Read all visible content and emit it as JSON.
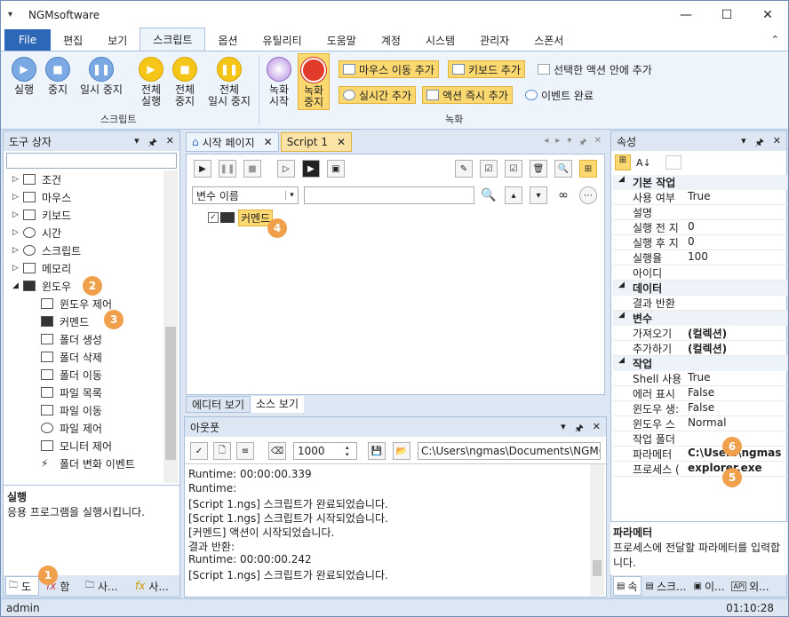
{
  "app": {
    "title": "NGMsoftware"
  },
  "menu": {
    "tabs": [
      "File",
      "편집",
      "보기",
      "스크립트",
      "옵션",
      "유틸리티",
      "도움말",
      "계정",
      "시스템",
      "관리자",
      "스폰서"
    ],
    "active": "스크립트"
  },
  "ribbon": {
    "run": "실행",
    "stop": "중지",
    "pause": "일시 중지",
    "run_all": [
      "전체",
      "실행"
    ],
    "stop_all": [
      "전체",
      "중지"
    ],
    "pause_all": [
      "전체",
      "일시 중지"
    ],
    "script_group": "스크립트",
    "rec_start": [
      "녹화",
      "시작"
    ],
    "rec_stop": [
      "녹화",
      "중지"
    ],
    "add_mouse": "마우스 이동 추가",
    "add_keyboard": "키보드 추가",
    "add_in_action": "선택한 액션 안에 추가",
    "add_realtime": "실시간 추가",
    "add_action_now": "액션 즉시 추가",
    "event_done": "이벤트 완료",
    "record_group": "녹화"
  },
  "toolbox": {
    "title": "도구 상자",
    "items": [
      "조건",
      "마우스",
      "키보드",
      "시간",
      "스크립트",
      "메모리",
      "윈도우"
    ],
    "children": [
      "윈도우 제어",
      "커멘드",
      "폴더 생성",
      "폴더 삭제",
      "폴더 이동",
      "파일 목록",
      "파일 이동",
      "파일 제어",
      "모니터 제어",
      "폴더 변화 이벤트"
    ],
    "desc_title": "실행",
    "desc_text": "응용 프로그램을 실행시킵니다.",
    "bottom_tabs": [
      "도",
      "함",
      "사...",
      "사..."
    ]
  },
  "editor": {
    "tabs": [
      "시작 페이지",
      "Script 1"
    ],
    "var_select": "변수 이름",
    "node_label": "커멘드",
    "view_tabs": [
      "에디터 보기",
      "소스 보기"
    ]
  },
  "output": {
    "title": "아웃풋",
    "count": "1000",
    "path": "C:\\Users\\ngmas\\Documents\\NGM6\\",
    "lines": [
      "Runtime: 00:00:00.339",
      "Runtime:",
      "[Script 1.ngs] 스크립트가 완료되었습니다.",
      "[Script 1.ngs] 스크립트가 시작되었습니다.",
      "[커멘드] 액션이 시작되었습니다.",
      "결과 반환:",
      "Runtime: 00:00:00.242",
      "[Script 1.ngs] 스크립트가 완료되었습니다."
    ]
  },
  "properties": {
    "title": "속성",
    "rows": [
      {
        "cat": true,
        "k": "기본 작업"
      },
      {
        "k": "사용 여부",
        "v": "True"
      },
      {
        "k": "설명",
        "v": ""
      },
      {
        "k": "실행 전 지",
        "v": "0"
      },
      {
        "k": "실행 후 지",
        "v": "0"
      },
      {
        "k": "실행율",
        "v": "100"
      },
      {
        "k": "아이디",
        "v": ""
      },
      {
        "cat": true,
        "k": "데이터"
      },
      {
        "k": "결과 반환",
        "v": ""
      },
      {
        "cat": true,
        "k": "변수"
      },
      {
        "k": "가져오기",
        "v": "(컬렉션)",
        "bold": true
      },
      {
        "k": "추가하기",
        "v": "(컬렉션)",
        "bold": true
      },
      {
        "cat": true,
        "k": "작업"
      },
      {
        "k": "Shell 사용",
        "v": "True"
      },
      {
        "k": "에러 표시",
        "v": "False"
      },
      {
        "k": "윈도우 생:",
        "v": "False"
      },
      {
        "k": "윈도우 스",
        "v": "Normal"
      },
      {
        "k": "작업 폴더",
        "v": ""
      },
      {
        "k": "파라메터",
        "v": "C:\\Users\\ngmas",
        "bold": true
      },
      {
        "k": "프로세스 (",
        "v": "explorer.exe",
        "bold": true
      }
    ],
    "desc_title": "파라메터",
    "desc_text": "프로세스에 전달할 파라메터를 입력합니다.",
    "bottom_tabs": [
      "속",
      "스크...",
      "이...",
      "외..."
    ]
  },
  "status": {
    "user": "admin",
    "time": "01:10:28"
  },
  "badges": [
    "1",
    "2",
    "3",
    "4",
    "5",
    "6"
  ]
}
